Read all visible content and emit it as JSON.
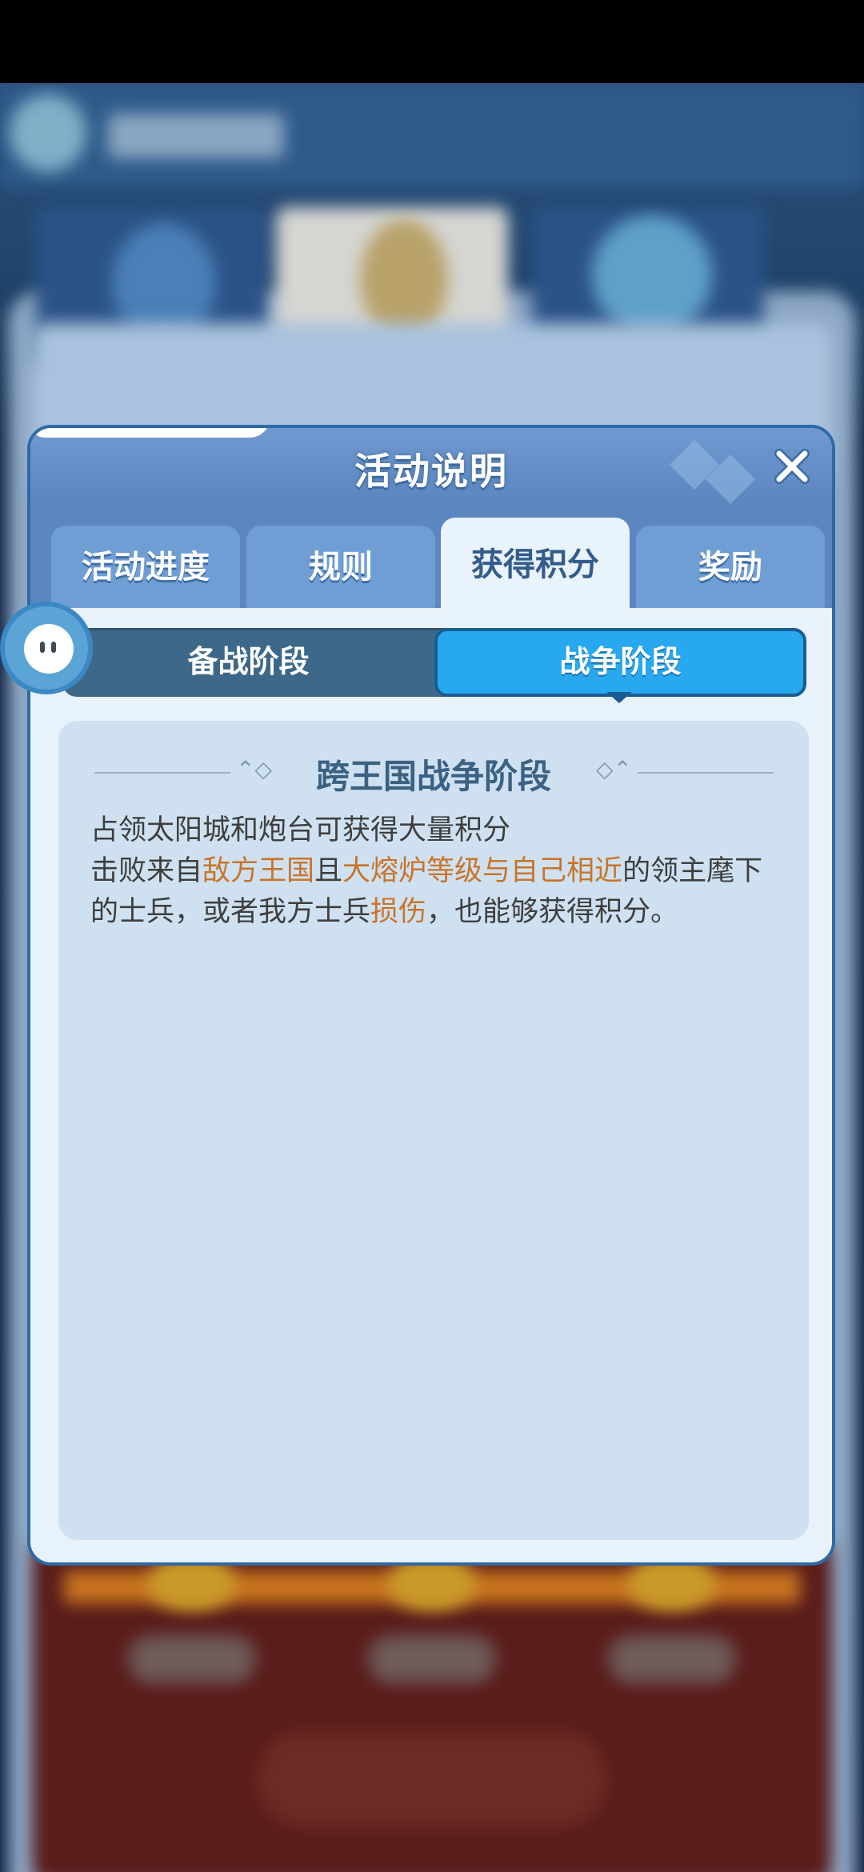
{
  "dialog": {
    "title": "活动说明",
    "close_icon": "close-icon"
  },
  "tabs": [
    {
      "label": "活动进度",
      "active": false
    },
    {
      "label": "规则",
      "active": false
    },
    {
      "label": "获得积分",
      "active": true
    },
    {
      "label": "奖励",
      "active": false
    }
  ],
  "phase_toggle": {
    "left_label": "备战阶段",
    "right_label": "战争阶段",
    "selected": "战争阶段"
  },
  "content": {
    "heading": "跨王国战争阶段",
    "line1": "占领太阳城和炮台可获得大量积分",
    "line2_parts": [
      {
        "text": "击败来自",
        "highlight": false
      },
      {
        "text": "敌方王国",
        "highlight": true
      },
      {
        "text": "且",
        "highlight": false
      },
      {
        "text": "大熔炉等级与自己相近",
        "highlight": true
      },
      {
        "text": "的领主麾下的士兵，或者我方士兵",
        "highlight": false
      },
      {
        "text": "损伤",
        "highlight": true
      },
      {
        "text": "，也能够获得积分。",
        "highlight": false
      }
    ]
  },
  "colors": {
    "highlight": "#c8742a",
    "selected_phase": "#27a8ef",
    "titlebar": "#5b86c0"
  },
  "assistant": {
    "icon": "assistant-mascot-icon"
  }
}
